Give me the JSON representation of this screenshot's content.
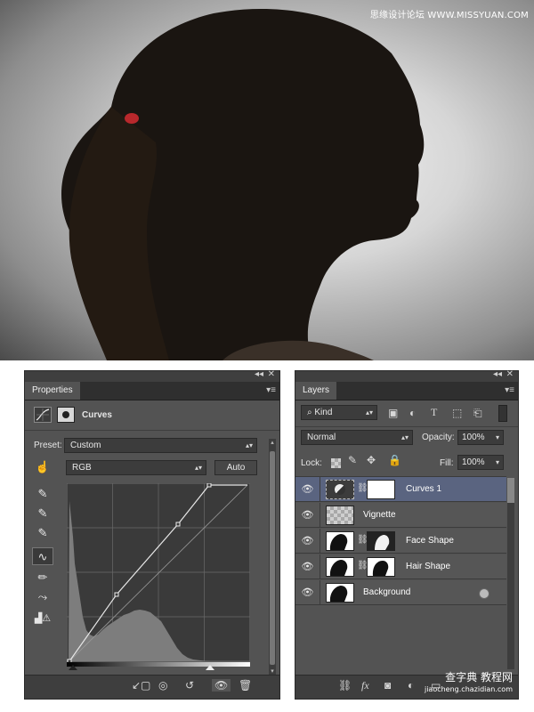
{
  "watermark": "思缘设计论坛 WWW.MISSYUAN.COM",
  "photo": {
    "subject": "profile silhouette of woman with ponytail"
  },
  "properties": {
    "tab": "Properties",
    "title": "Curves",
    "preset_label": "Preset:",
    "preset_value": "Custom",
    "channel": "RGB",
    "auto_label": "Auto"
  },
  "layers": {
    "tab": "Layers",
    "filter_kind": "Kind",
    "blend_mode": "Normal",
    "opacity_label": "Opacity:",
    "opacity_value": "100%",
    "lock_label": "Lock:",
    "fill_label": "Fill:",
    "fill_value": "100%",
    "items": [
      {
        "name": "Curves 1",
        "selected": true
      },
      {
        "name": "Vignette",
        "selected": false
      },
      {
        "name": "Face Shape",
        "selected": false
      },
      {
        "name": "Hair Shape",
        "selected": false
      },
      {
        "name": "Background",
        "selected": false
      }
    ]
  },
  "bottom_watermark": "查字典 教程网",
  "bottom_watermark_url": "jiaocheng.chazidian.com",
  "colors": {
    "panel": "#535353",
    "dark": "#3c3c3c",
    "selected": "#5a6480"
  }
}
